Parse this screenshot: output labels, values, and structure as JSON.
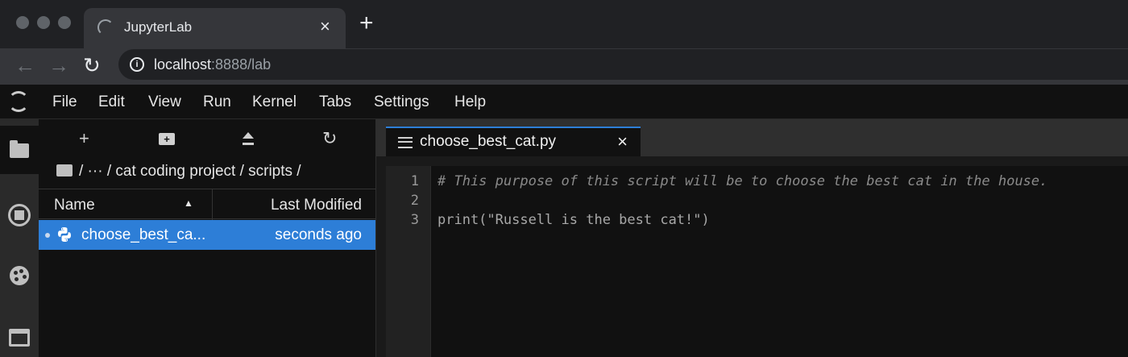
{
  "browser": {
    "tab_title": "JupyterLab",
    "new_tab_label": "+",
    "close_label": "×",
    "url_host": "localhost",
    "url_rest": ":8888/lab"
  },
  "menu": [
    "File",
    "Edit",
    "View",
    "Run",
    "Kernel",
    "Tabs",
    "Settings",
    "Help"
  ],
  "filebrowser": {
    "toolbar": {
      "new_launcher": "+",
      "refresh": "↻",
      "new_folder_glyph": "+"
    },
    "breadcrumb": "/ ··· / cat coding project / scripts /",
    "columns": {
      "name": "Name",
      "sort_indicator": "▲",
      "modified": "Last Modified"
    },
    "files": [
      {
        "name": "choose_best_ca...",
        "modified": "seconds ago"
      }
    ]
  },
  "editor": {
    "tab_label": "choose_best_cat.py",
    "close_label": "×",
    "line_numbers": [
      "1",
      "2",
      "3"
    ],
    "lines": [
      "# This purpose of this script will be to choose the best cat in the house.",
      "",
      "print(\"Russell is the best cat!\")"
    ]
  },
  "icons": {
    "activity": [
      "folder-icon",
      "running-icon",
      "palette-icon",
      "tabs-icon"
    ]
  },
  "colors": {
    "accent": "#2d7ed7",
    "background": "#111111"
  }
}
